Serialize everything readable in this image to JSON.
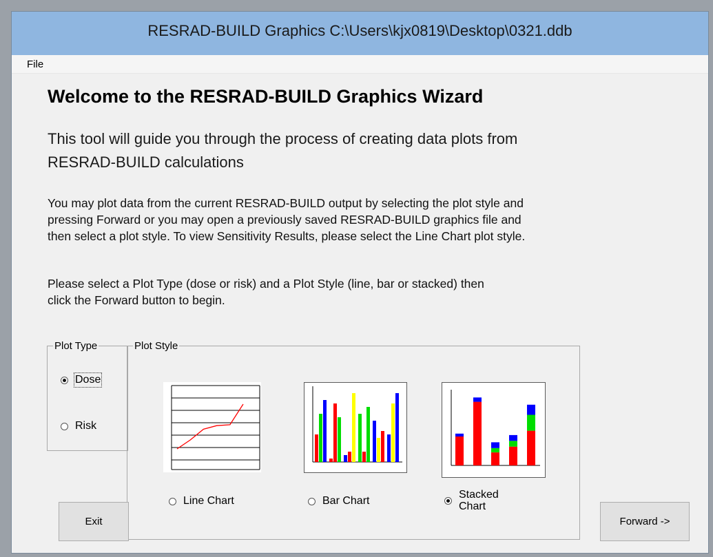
{
  "window": {
    "title": "RESRAD-BUILD Graphics C:\\Users\\kjx0819\\Desktop\\0321.ddb"
  },
  "menu": {
    "items": [
      {
        "label": "File"
      }
    ]
  },
  "content": {
    "heading": "Welcome to the RESRAD-BUILD Graphics Wizard",
    "intro_line1": "This tool will guide you through the process of creating data plots from",
    "intro_line2": "RESRAD-BUILD calculations",
    "para1_line1": "You may plot data from the current RESRAD-BUILD output by selecting the plot style and",
    "para1_line2": "pressing Forward or you may open a previously saved RESRAD-BUILD graphics file and",
    "para1_line3": "then select a plot style. To view Sensitivity Results, please select the Line Chart plot style.",
    "para2_line1": "Please select a Plot Type (dose or risk) and a Plot Style (line, bar or stacked) then",
    "para2_line2": "click the Forward button to begin."
  },
  "plot_type": {
    "legend": "Plot Type",
    "options": [
      {
        "label": "Dose",
        "selected": true
      },
      {
        "label": "Risk",
        "selected": false
      }
    ]
  },
  "plot_style": {
    "legend": "Plot Style",
    "options": [
      {
        "label": "Line Chart",
        "selected": false
      },
      {
        "label": "Bar Chart",
        "selected": false
      },
      {
        "label_line1": "Stacked",
        "label_line2": "Chart",
        "selected": true
      }
    ]
  },
  "buttons": {
    "exit": "Exit",
    "forward": "Forward ->"
  },
  "thumbnails": {
    "line": {
      "color": "#ff0000",
      "values": [
        1,
        2,
        3.2,
        3.6,
        3.7,
        6
      ]
    },
    "bar": {
      "groups": [
        [
          {
            "color": "#ff0000",
            "value": 0.4
          },
          {
            "color": "#00dd00",
            "value": 0.7
          },
          {
            "color": "#0000ff",
            "value": 0.9
          }
        ],
        [
          {
            "color": "#ff0000",
            "value": 0.05
          },
          {
            "color": "#ff0000",
            "value": 0.85
          },
          {
            "color": "#00dd00",
            "value": 0.65
          }
        ],
        [
          {
            "color": "#0000ff",
            "value": 0.1
          },
          {
            "color": "#ff0000",
            "value": 0.15
          },
          {
            "color": "#ffff00",
            "value": 1.0
          }
        ],
        [
          {
            "color": "#00dd00",
            "value": 0.7
          },
          {
            "color": "#ff0000",
            "value": 0.15
          },
          {
            "color": "#00dd00",
            "value": 0.8
          }
        ],
        [
          {
            "color": "#0000ff",
            "value": 0.6
          },
          {
            "color": "#ffff00",
            "value": 0.35
          },
          {
            "color": "#ff0000",
            "value": 0.45
          }
        ],
        [
          {
            "color": "#0000ff",
            "value": 0.4
          },
          {
            "color": "#ffff00",
            "value": 0.85
          },
          {
            "color": "#0000ff",
            "value": 1.0
          }
        ]
      ]
    },
    "stacked": {
      "bars": [
        [
          {
            "color": "#ff0000",
            "value": 2.0
          },
          {
            "color": "#0000ff",
            "value": 0.2
          }
        ],
        [
          {
            "color": "#ff0000",
            "value": 4.4
          },
          {
            "color": "#0000ff",
            "value": 0.3
          }
        ],
        [
          {
            "color": "#ff0000",
            "value": 0.9
          },
          {
            "color": "#00dd00",
            "value": 0.3
          },
          {
            "color": "#0000ff",
            "value": 0.4
          }
        ],
        [
          {
            "color": "#ff0000",
            "value": 1.3
          },
          {
            "color": "#00dd00",
            "value": 0.4
          },
          {
            "color": "#0000ff",
            "value": 0.4
          }
        ],
        [
          {
            "color": "#ff0000",
            "value": 2.4
          },
          {
            "color": "#00dd00",
            "value": 1.1
          },
          {
            "color": "#0000ff",
            "value": 0.7
          }
        ]
      ]
    }
  }
}
